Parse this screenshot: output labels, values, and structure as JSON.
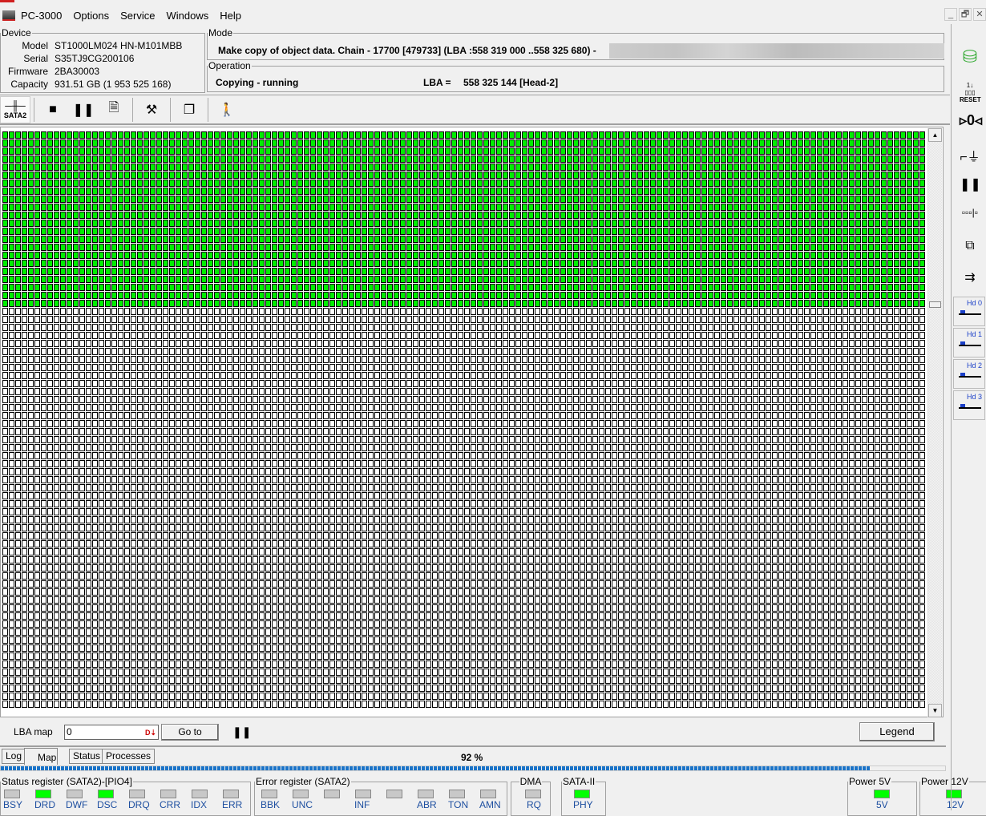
{
  "menu": {
    "app": "PC-3000",
    "items": [
      "Options",
      "Service",
      "Windows",
      "Help"
    ]
  },
  "window_controls": [
    "_",
    "🗗",
    "✕"
  ],
  "device": {
    "title": "Device",
    "model_label": "Model",
    "model": "ST1000LM024 HN-M101MBB",
    "serial_label": "Serial",
    "serial": "S35TJ9CG200106",
    "firmware_label": "Firmware",
    "firmware": "2BA30003",
    "capacity_label": "Capacity",
    "capacity": "931.51 GB (1 953 525 168)"
  },
  "mode": {
    "title": "Mode",
    "text": "Make copy of object data. Chain - 17700 [479733] (LBA :558 319 000 ..558 325 680) -"
  },
  "operation": {
    "title": "Operation",
    "status": "Copying - running",
    "lba_label": "LBA =",
    "lba_value": "558 325 144  [Head-2]"
  },
  "toolbar": {
    "sata_label": "SATA2"
  },
  "map": {
    "columns": 144,
    "rows": 72,
    "completed_rows": 22,
    "completed_color": "#00ee00"
  },
  "lba_map": {
    "label": "LBA map",
    "value": "0",
    "goto": "Go to",
    "legend": "Legend"
  },
  "tabs": [
    "Log",
    "Map",
    "Status",
    "Processes"
  ],
  "active_tab": "Map",
  "progress": {
    "text": "92 %",
    "value": 92
  },
  "status_register": {
    "title": "Status register (SATA2)-[PIO4]",
    "leds": [
      {
        "l": "BSY",
        "on": false
      },
      {
        "l": "DRD",
        "on": true
      },
      {
        "l": "DWF",
        "on": false
      },
      {
        "l": "DSC",
        "on": true
      },
      {
        "l": "DRQ",
        "on": false
      },
      {
        "l": "CRR",
        "on": false
      },
      {
        "l": "IDX",
        "on": false
      },
      {
        "l": "ERR",
        "on": false
      }
    ]
  },
  "error_register": {
    "title": "Error register (SATA2)",
    "leds": [
      {
        "l": "BBK",
        "on": false
      },
      {
        "l": "UNC",
        "on": false
      },
      {
        "l": "",
        "on": false
      },
      {
        "l": "INF",
        "on": false
      },
      {
        "l": "",
        "on": false
      },
      {
        "l": "ABR",
        "on": false
      },
      {
        "l": "TON",
        "on": false
      },
      {
        "l": "AMN",
        "on": false
      }
    ]
  },
  "dma": {
    "title": "DMA",
    "label": "RQ"
  },
  "sata": {
    "title": "SATA-II",
    "label": "PHY"
  },
  "power5": {
    "title": "Power 5V",
    "label": "5V"
  },
  "power12": {
    "title": "Power 12V",
    "label": "12V"
  },
  "side": {
    "heads": [
      "Hd 0",
      "Hd 1",
      "Hd 2",
      "Hd 3"
    ],
    "reset": "RESET"
  }
}
